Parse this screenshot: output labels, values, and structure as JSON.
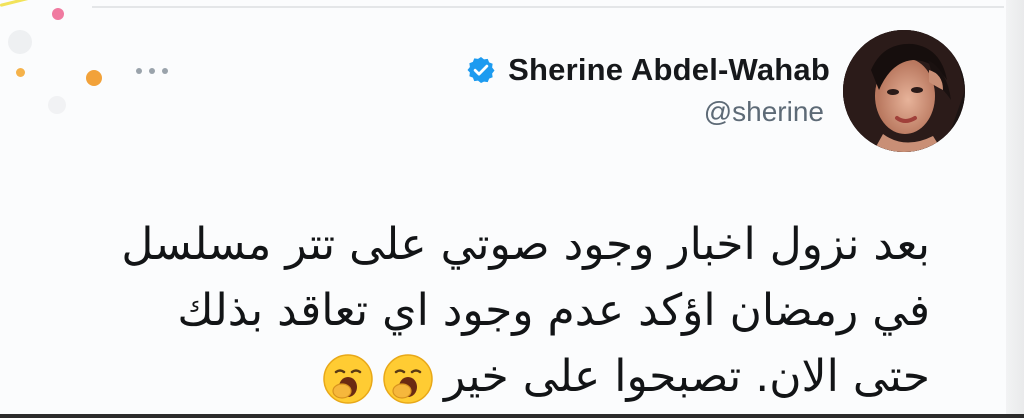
{
  "tweet": {
    "author": {
      "display_name": "Sherine Abdel-Wahab",
      "handle": "@sherine",
      "verified": true,
      "verified_icon": "verified-badge-icon",
      "verified_color": "#1d9bf0"
    },
    "more_menu_icon": "more-horizontal-icon",
    "text_lines": [
      "بعد نزول اخبار وجود صوتي على تتر مسلسل",
      "في رمضان اؤكد عدم وجود اي تعاقد بذلك",
      "حتى الان.  تصبحوا على خير"
    ],
    "emojis": [
      "yawning-face-icon",
      "yawning-face-icon"
    ]
  }
}
